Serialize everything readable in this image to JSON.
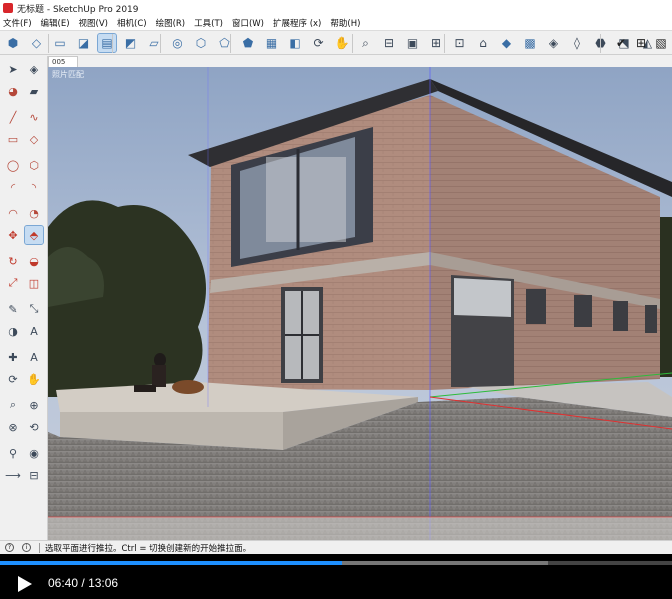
{
  "window": {
    "title": "无标题 - SketchUp Pro 2019"
  },
  "menu": [
    "文件(F)",
    "编辑(E)",
    "视图(V)",
    "相机(C)",
    "绘图(R)",
    "工具(T)",
    "窗口(W)",
    "扩展程序 (x)",
    "帮助(H)"
  ],
  "toolbar": {
    "icons": [
      "iso-view-icon",
      "top-view-icon",
      "front-view-icon",
      "right-view-icon",
      "back-view-icon",
      "left-view-icon",
      "bottom-view-icon",
      "xray-icon",
      "wireframe-icon",
      "hidden-line-icon",
      "shaded-icon",
      "shaded-texture-icon",
      "monochrome-icon",
      "orbit-icon",
      "pan-icon",
      "zoom-icon",
      "section-plane-icon",
      "section-fill-icon",
      "section-cut-icon",
      "section-display-icon",
      "lock-icon",
      "box-icon",
      "sandbox-icon",
      "stamp-icon",
      "drape-icon",
      "add-detail-icon",
      "flip-edge-icon",
      "smoove-icon",
      "table-icon",
      "check-icon",
      "layout-icon"
    ],
    "selected_index": 4
  },
  "palette": {
    "tools": [
      "select-icon",
      "component-icon",
      "paint-bucket-icon",
      "eraser-icon",
      "line-icon",
      "freehand-icon",
      "rectangle-icon",
      "rotated-rectangle-icon",
      "circle-icon",
      "polygon-icon",
      "arc-icon",
      "two-point-arc-icon",
      "three-point-arc-icon",
      "pie-icon",
      "move-icon",
      "push-pull-icon",
      "rotate-icon",
      "follow-me-icon",
      "scale-icon",
      "offset-icon",
      "tape-measure-icon",
      "dimension-icon",
      "protractor-icon",
      "text-icon",
      "axes-icon",
      "3d-text-icon",
      "orbit-icon",
      "pan-icon",
      "zoom-icon",
      "zoom-window-icon",
      "zoom-extents-icon",
      "previous-icon",
      "position-camera-icon",
      "look-around-icon",
      "walk-icon",
      "section-plane-icon"
    ],
    "selected": "push-pull-icon"
  },
  "scene": {
    "tab_label": "005",
    "match_photo_label": "照片匹配"
  },
  "status": {
    "message": "选取平面进行推拉。Ctrl = 切换创建新的开始推拉面。"
  },
  "player": {
    "current_time": "06:40",
    "separator": "/",
    "duration": "13:06",
    "progress": 0.509,
    "buffered": 0.815
  },
  "colors": {
    "accent": "#1e90ff",
    "selection": "#c6dcf2"
  }
}
